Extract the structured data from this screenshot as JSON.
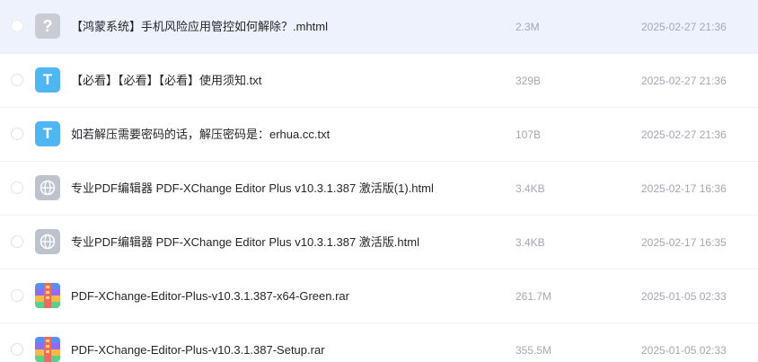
{
  "files": [
    {
      "name": "【鸿蒙系统】手机风险应用管控如何解除？.mhtml",
      "size": "2.3M",
      "date": "2025-02-27 21:36",
      "icon": "unknown-file-icon",
      "icon_glyph": "?",
      "selected": true
    },
    {
      "name": "【必看】【必看】【必看】使用须知.txt",
      "size": "329B",
      "date": "2025-02-27 21:36",
      "icon": "text-file-icon",
      "icon_glyph": "T"
    },
    {
      "name": "如若解压需要密码的话，解压密码是：erhua.cc.txt",
      "size": "107B",
      "date": "2025-02-27 21:36",
      "icon": "text-file-icon",
      "icon_glyph": "T"
    },
    {
      "name": "专业PDF编辑器 PDF-XChange Editor Plus v10.3.1.387 激活版(1).html",
      "size": "3.4KB",
      "date": "2025-02-17 16:36",
      "icon": "web-file-icon"
    },
    {
      "name": "专业PDF编辑器 PDF-XChange Editor Plus v10.3.1.387 激活版.html",
      "size": "3.4KB",
      "date": "2025-02-17 16:35",
      "icon": "web-file-icon"
    },
    {
      "name": "PDF-XChange-Editor-Plus-v10.3.1.387-x64-Green.rar",
      "size": "261.7M",
      "date": "2025-01-05 02:33",
      "icon": "archive-file-icon"
    },
    {
      "name": "PDF-XChange-Editor-Plus-v10.3.1.387-Setup.rar",
      "size": "355.5M",
      "date": "2025-01-05 02:33",
      "icon": "archive-file-icon"
    }
  ],
  "colors": {
    "selected_row_bg": "#eef2fc",
    "txt_icon": "#4fb6f2",
    "unknown_icon": "#c9ccd4",
    "web_icon": "#bdc3cd",
    "meta_text": "#a3a8b2",
    "name_text": "#25262b"
  }
}
